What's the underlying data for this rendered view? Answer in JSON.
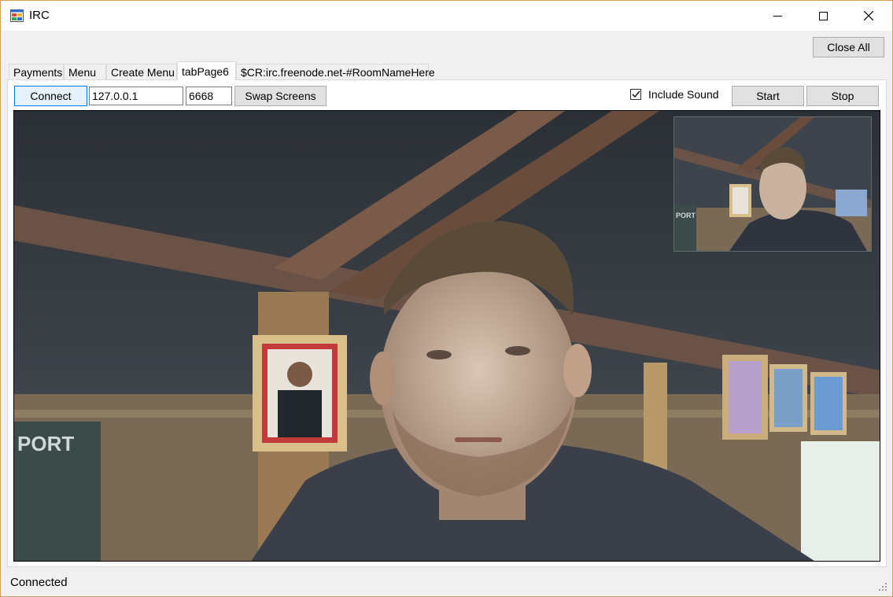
{
  "window": {
    "title": "IRC",
    "icon": "app-window-icon",
    "controls": [
      "minimize-icon",
      "maximize-icon",
      "close-icon"
    ]
  },
  "toolbar": {
    "close_all_label": "Close All"
  },
  "tabs": [
    {
      "label": "Payments"
    },
    {
      "label": "Menu"
    },
    {
      "label": "Create Menu"
    },
    {
      "label": "tabPage6"
    },
    {
      "label": "$CR:irc.freenode.net-#RoomNameHere"
    }
  ],
  "active_tab": "tabPage6",
  "connection": {
    "connect_label": "Connect",
    "host_value": "127.0.0.1",
    "port_value": "6668",
    "swap_label": "Swap Screens",
    "include_sound_label": "Include Sound",
    "include_sound_checked": true,
    "start_label": "Start",
    "stop_label": "Stop"
  },
  "video": {
    "main": "webcam-video-main",
    "pip": "webcam-video-preview"
  },
  "status": {
    "text": "Connected"
  },
  "colors": {
    "window_border": "#d59c52",
    "accent": "#0078d7"
  }
}
